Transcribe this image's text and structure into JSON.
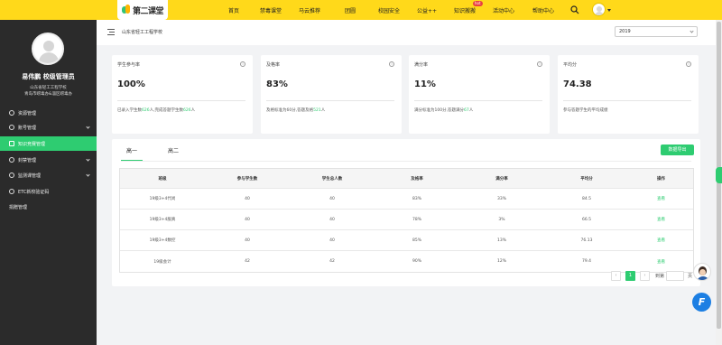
{
  "logo": {
    "text": "第二课堂"
  },
  "nav": {
    "items": [
      "首页",
      "禁毒课堂",
      "马云推荐",
      "团圆",
      "校园安全",
      "公益++",
      "知识搬搬",
      "活动中心",
      "帮助中心"
    ],
    "hot_badge": "hot"
  },
  "sidebar": {
    "user_name": "易伟鹏 校级管理员",
    "org_line1": "山东省轻工工程学校",
    "org_line2": "青岛市崂毒办&淄区崂毒办",
    "menu": [
      {
        "label": "资源管理",
        "has_chevron": false,
        "active": false
      },
      {
        "label": "账号管理",
        "has_chevron": true,
        "active": false
      },
      {
        "label": "知识竞赛管理",
        "has_chevron": false,
        "active": true
      },
      {
        "label": "封禁管理",
        "has_chevron": true,
        "active": false
      },
      {
        "label": "监测课管理",
        "has_chevron": true,
        "active": false
      },
      {
        "label": "ETC新校验证码",
        "has_chevron": false,
        "active": false
      },
      {
        "label": "捐赠管理",
        "has_chevron": false,
        "active": false
      }
    ]
  },
  "breadcrumb": {
    "school": "山东省轻工工程学校"
  },
  "year_select": {
    "value": "2019"
  },
  "cards": [
    {
      "label": "学生参与率",
      "value": "100%",
      "desc_pre": "已录入学生数",
      "desc_hl1": "626",
      "desc_mid": "人,完成答题学生数",
      "desc_hl2": "626",
      "desc_post": "人"
    },
    {
      "label": "及格率",
      "value": "83%",
      "desc_pre": "及格标准为60分,答题及格",
      "desc_hl1": "521",
      "desc_mid": "人",
      "desc_hl2": "",
      "desc_post": ""
    },
    {
      "label": "满分率",
      "value": "11%",
      "desc_pre": "满分标准为100分,答题满分",
      "desc_hl1": "67",
      "desc_mid": "人",
      "desc_hl2": "",
      "desc_post": ""
    },
    {
      "label": "平均分",
      "value": "74.38",
      "desc_pre": "参与答题学生的平均成绩",
      "desc_hl1": "",
      "desc_mid": "",
      "desc_hl2": "",
      "desc_post": ""
    }
  ],
  "tabs": [
    "高一",
    "高二"
  ],
  "export_button": "数据导出",
  "table": {
    "headers": [
      "班级",
      "参与学生数",
      "学生总人数",
      "及格率",
      "满分率",
      "平均分",
      "操作"
    ],
    "rows": [
      [
        "19级3+4代尚",
        "40",
        "40",
        "83%",
        "33%",
        "84.5",
        "查看"
      ],
      [
        "19级3+4服真",
        "40",
        "40",
        "78%",
        "3%",
        "66.5",
        "查看"
      ],
      [
        "19级3+4数控",
        "40",
        "40",
        "85%",
        "13%",
        "76.13",
        "查看"
      ],
      [
        "19级会计",
        "42",
        "42",
        "90%",
        "12%",
        "79.4",
        "查看"
      ]
    ]
  },
  "pagination": {
    "current": "1",
    "goto_label": "到第",
    "suffix": "页"
  },
  "icons": [
    "search-icon",
    "menu-toggle-icon",
    "info-icon",
    "chevron-down-icon",
    "feedback-icon"
  ],
  "colors": {
    "brand_yellow": "#ffd91a",
    "accent_green": "#2ecc71",
    "sidebar_dark": "#2b2b2b",
    "float_blue": "#1d7fe3"
  }
}
